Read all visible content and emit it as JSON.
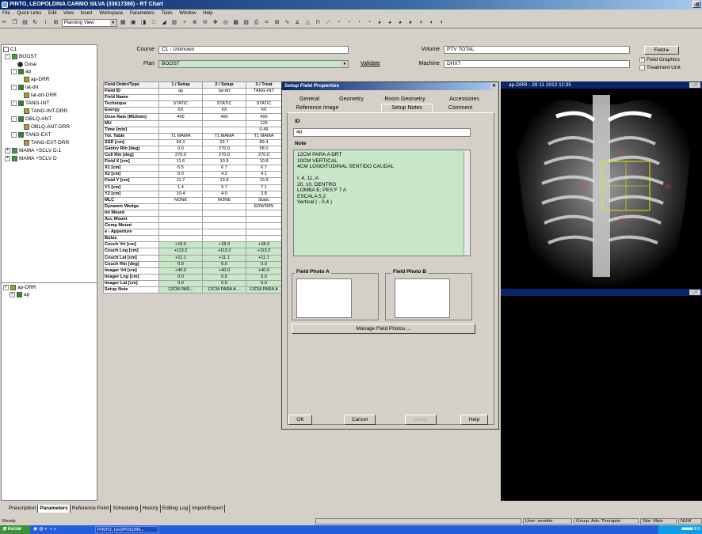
{
  "window": {
    "title": "PINTO, LEOPOLDINA CARMO SILVA (33617388) - RT Chart",
    "close_label": "-8"
  },
  "menu": [
    "File",
    "Quick Links",
    "Edit",
    "View",
    "Insert",
    "Workspace",
    "Parameters",
    "Tools",
    "Window",
    "Help"
  ],
  "toolbar": {
    "view_select": "Planning View"
  },
  "tree": {
    "items": [
      {
        "label": "C1",
        "icon": "c1-icon"
      },
      {
        "label": "BOOST",
        "icon": "plan-icon"
      },
      {
        "label": "Dose",
        "icon": "dose-icon"
      },
      {
        "label": "ap",
        "icon": "beam-icon"
      },
      {
        "label": "ap-DRR",
        "icon": "drr-icon"
      },
      {
        "label": "lat-drt",
        "icon": "beam-icon"
      },
      {
        "label": "lat-drt-DRR",
        "icon": "drr-icon"
      },
      {
        "label": "TANG-INT",
        "icon": "beam-icon"
      },
      {
        "label": "TANG-INT-DRR",
        "icon": "drr-icon"
      },
      {
        "label": "OBLQ-ANT",
        "icon": "beam-icon"
      },
      {
        "label": "OBLQ-ANT-DRR",
        "icon": "drr-icon"
      },
      {
        "label": "TANG-EXT",
        "icon": "beam-icon"
      },
      {
        "label": "TANG-EXT-DRR",
        "icon": "drr-icon"
      },
      {
        "label": "MAMA +SCLV D.1",
        "icon": "plan-icon"
      },
      {
        "label": "MAMA +SCLV D",
        "icon": "plan-icon"
      }
    ],
    "lower_items": [
      {
        "label": "ap-DRR",
        "icon": "drr-icon"
      },
      {
        "label": "ap",
        "icon": "beam-icon"
      }
    ]
  },
  "course": {
    "course_label": "Course",
    "course_value": "C1 - Unknown",
    "plan_label": "Plan",
    "plan_value": "BOOST",
    "validate_label": "Validate",
    "volume_label": "Volume",
    "volume_value": "PTV TOTAL",
    "machine_label": "Machine",
    "machine_value": "DHX7"
  },
  "right_panel": {
    "field_button": "Field",
    "field_graphics": "Field Graphics",
    "treatment_unit": "Treatment Unit"
  },
  "grid": {
    "columns": [
      "Field Order/Type",
      "1 / Setup",
      "2 / Setup",
      "3 / Treat"
    ],
    "rows": [
      [
        "Field ID",
        "ap",
        "lat-drt",
        "TANG-INT"
      ],
      [
        "Field Name",
        "",
        "",
        ""
      ],
      [
        "Technique",
        "STATIC",
        "STATIC",
        "STATIC"
      ],
      [
        "Energy",
        "6X",
        "6X",
        "6X"
      ],
      [
        "Dose Rate [MU/min]",
        "400",
        "400",
        "400"
      ],
      [
        "MU",
        "",
        "",
        "129"
      ],
      [
        "Time [min]",
        "",
        "",
        "0.49"
      ],
      [
        "Tol. Table",
        "T1 MAMA",
        "T1 MAMA",
        "T1 MAMA"
      ],
      [
        "SSD [cm]",
        "94.0",
        "92.7",
        "89.4"
      ],
      [
        "Gantry Rtn [deg]",
        "0.0",
        "270.0",
        "58.0"
      ],
      [
        "Coll Rtn [deg]",
        "270.0",
        "270.0",
        "270.0"
      ],
      [
        "Field X [cm]",
        "11.6",
        "10.9",
        "10.8"
      ],
      [
        "X1 [cm]",
        "6.5",
        "6.7",
        "6.7"
      ],
      [
        "X2 [cm]",
        "5.0",
        "4.2",
        "4.1"
      ],
      [
        "Field Y [cm]",
        "11.7",
        "13.8",
        "10.9"
      ],
      [
        "Y1 [cm]",
        "1.4",
        "9.7",
        "7.1"
      ],
      [
        "Y2 [cm]",
        "10.4",
        "4.0",
        "3.8"
      ],
      [
        "MLC",
        "NONE",
        "NONE",
        "Static"
      ],
      [
        "Dynamic Wedge",
        "",
        "",
        "EDW30IN"
      ],
      [
        "Int Mount",
        "",
        "",
        ""
      ],
      [
        "Acc Mount",
        "",
        "",
        ""
      ],
      [
        "Comp Mount",
        "",
        "",
        ""
      ],
      [
        "e - Apperture",
        "",
        "",
        ""
      ],
      [
        "Bolus",
        "",
        "",
        ""
      ],
      [
        "Couch Vrt [cm]",
        "+18.9",
        "+18.9",
        "+18.9"
      ],
      [
        "Couch Lng [cm]",
        "+113.2",
        "+113.2",
        "+113.2"
      ],
      [
        "Couch Lat [cm]",
        "+11.1",
        "+11.1",
        "+11.1"
      ],
      [
        "Couch Rtn [deg]",
        "0.0",
        "0.0",
        "0.0"
      ],
      [
        "Imager Vrt [cm]",
        "+40.0",
        "+40.0",
        "+40.0"
      ],
      [
        "Imager Lng [cm]",
        "0.0",
        "0.0",
        "0.0"
      ],
      [
        "Imager Lat [cm]",
        "0.0",
        "0.0",
        "0.0"
      ],
      [
        "Setup Note",
        "12CM PAR...",
        "12CM PARA A ...",
        "12CM PARA A"
      ]
    ]
  },
  "dialog": {
    "title": "Setup Field Properties",
    "tabs_row1": [
      "General",
      "Geometry",
      "Room Geometry",
      "Accessories"
    ],
    "tabs_row2": [
      "Reference Image",
      "Setup Notes",
      "Comment"
    ],
    "id_label": "ID",
    "id_value": "ap",
    "note_label": "Note",
    "note_text": "12CM PARA A DRT\n10CM VERTICAL\n4CM LONGITUDINAL SENTIDO CAUDAL\n\nI; 4, 11, A\n20, 10, DENTRO\nLOMBA E; PES F 7 A\nESCALA 5,2\nVertical ( - 0,4 )",
    "photo_a": "Field Photo A",
    "photo_b": "Field Photo B",
    "manage_photos": "Manage Field Photos ...",
    "ok": "OK",
    "cancel": "Cancel",
    "apply": "Apply",
    "help": "Help"
  },
  "image_view": {
    "title": "ap-DRR - 28 11 2012 11:35"
  },
  "bottom_tabs": [
    "Prescription",
    "Parameters",
    "Reference Point",
    "Scheduling",
    "History",
    "Editing Log",
    "Import/Export"
  ],
  "status": {
    "ready": "Ready",
    "user": "User: serafim",
    "group": "Group: Adv. Therapist",
    "site": "Site: Main",
    "num": "NUM"
  },
  "taskbar": {
    "start": "Iniciar",
    "program": "PINTO, LEOPOLDIN...",
    "time": "8:5"
  }
}
